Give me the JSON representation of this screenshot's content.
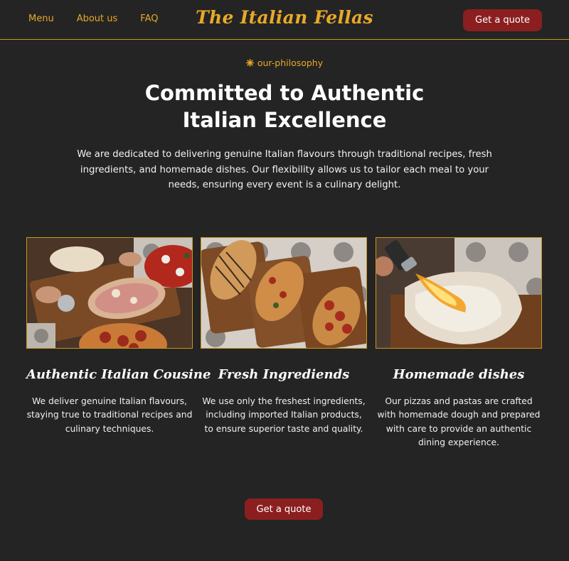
{
  "header": {
    "nav": [
      "Menu",
      "About us",
      "FAQ"
    ],
    "logo": "The Italian Fellas",
    "cta_label": "Get a quote"
  },
  "intro": {
    "eyebrow": "our-philosophy",
    "title": "Committed to Authentic Italian Excellence",
    "description": "We are dedicated to delivering genuine Italian flavours through traditional recipes, fresh ingredients, and homemade dishes. Our flexibility allows us to tailor each meal to your needs, ensuring every event is a culinary delight."
  },
  "cards": [
    {
      "title": "Authentic Italian Cousine",
      "text": "We deliver genuine Italian flavours, staying true to traditional recipes and culinary techniques.",
      "image": "pizza-slicing-photo"
    },
    {
      "title": "Fresh Ingrediends",
      "text": "We use only the freshest ingredients, including imported Italian products, to ensure superior taste and quality.",
      "image": "pizzas-on-boards-photo"
    },
    {
      "title": "Homemade dishes",
      "text": "Our pizzas and pastas are crafted with homemade dough and prepared with care to provide an authentic dining experience.",
      "image": "torch-flame-photo"
    }
  ],
  "bottom_cta": {
    "label": "Get a quote"
  },
  "colors": {
    "background": "#242424",
    "accent": "#e8a928",
    "button": "#8b1f1f",
    "divider": "#c9971c"
  }
}
